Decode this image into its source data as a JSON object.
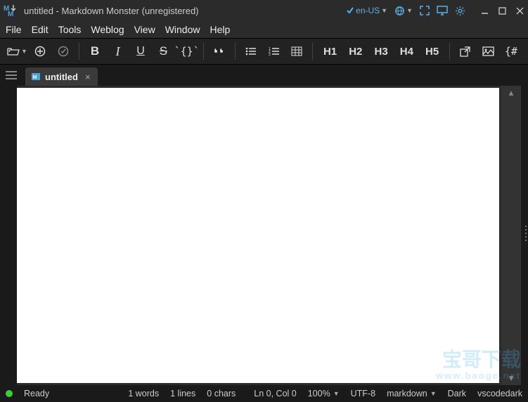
{
  "titlebar": {
    "title": "untitled  - Markdown Monster (unregistered)",
    "language": "en-US"
  },
  "menu": {
    "file": "File",
    "edit": "Edit",
    "tools": "Tools",
    "weblog": "Weblog",
    "view": "View",
    "window": "Window",
    "help": "Help"
  },
  "toolbar": {
    "h1": "H1",
    "h2": "H2",
    "h3": "H3",
    "h4": "H4",
    "h5": "H5"
  },
  "tab": {
    "title": "untitled"
  },
  "status": {
    "ready": "Ready",
    "words": "1 words",
    "lines": "1 lines",
    "chars": "0 chars",
    "position": "Ln 0, Col 0",
    "zoom": "100%",
    "encoding": "UTF-8",
    "language": "markdown",
    "theme_app": "Dark",
    "theme_editor": "vscodedark"
  },
  "watermark": {
    "line1": "宝哥下载",
    "line2": "www.baoge.net"
  },
  "editor": {
    "content": ""
  }
}
